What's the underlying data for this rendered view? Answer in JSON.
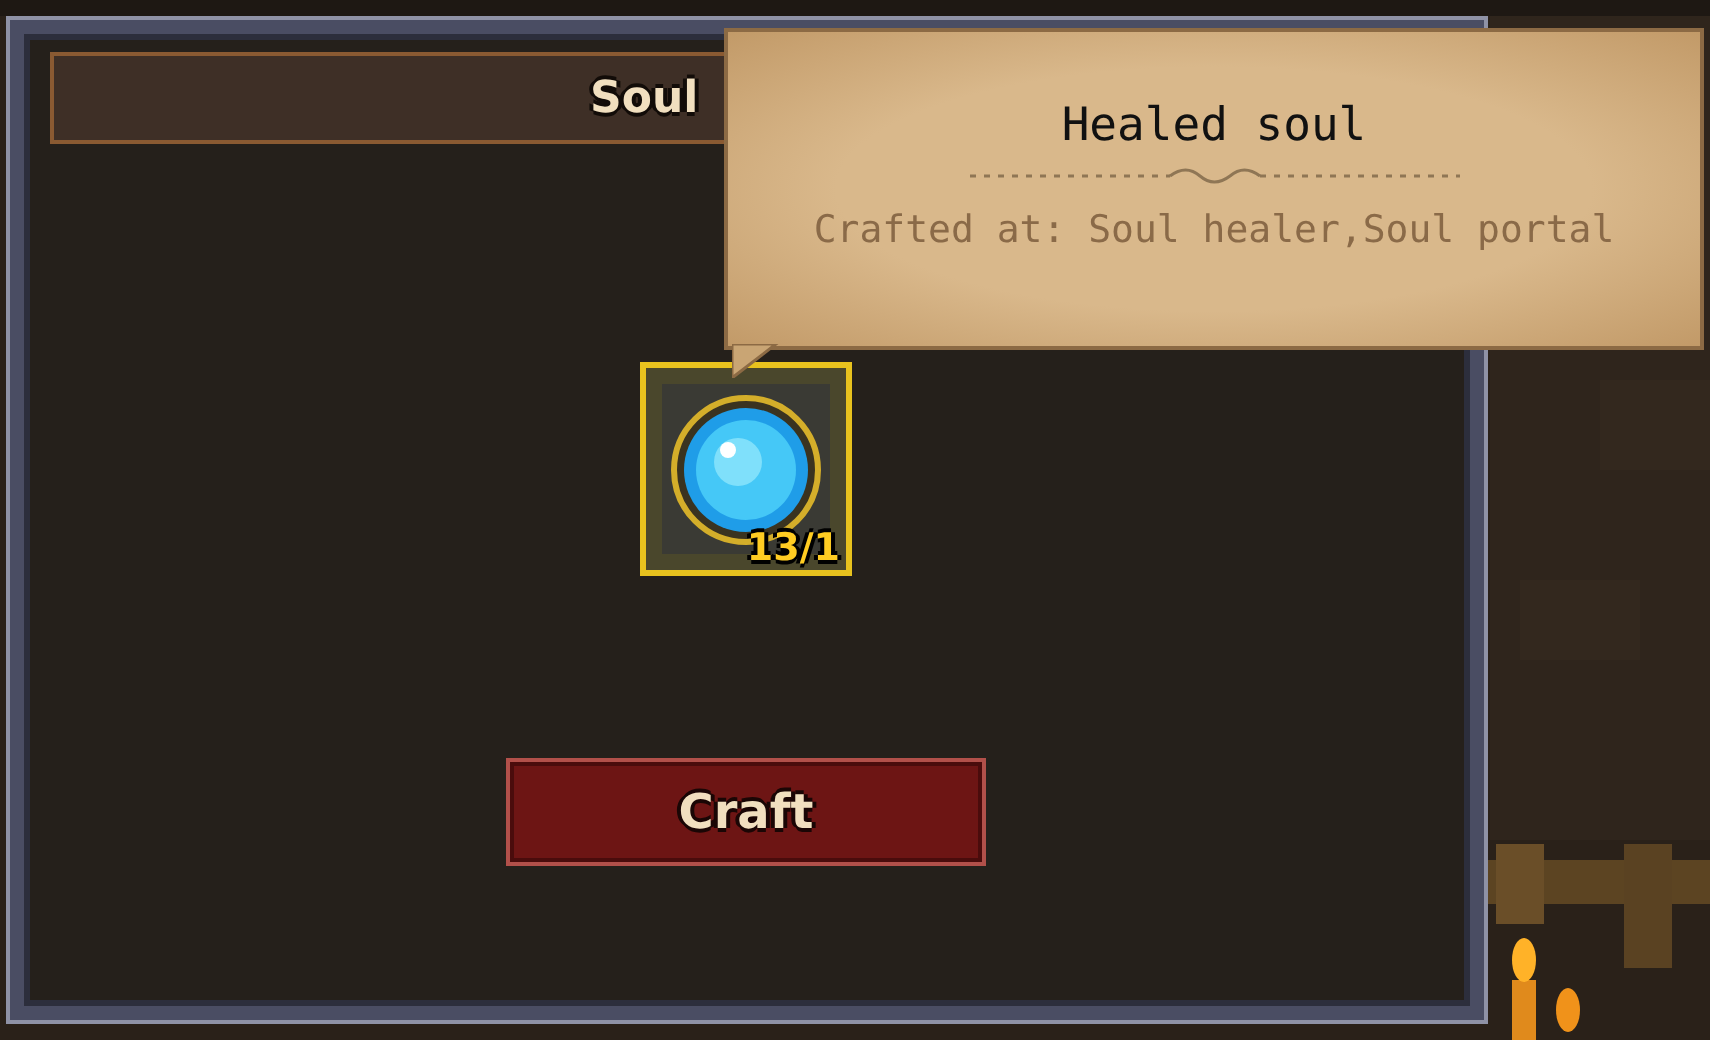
{
  "panel": {
    "title": "Soul"
  },
  "item": {
    "selected": true,
    "count": "13/1"
  },
  "tooltip": {
    "title": "Healed soul",
    "description": "Crafted at: Soul healer,Soul portal"
  },
  "craft_button": {
    "label": "Craft"
  }
}
